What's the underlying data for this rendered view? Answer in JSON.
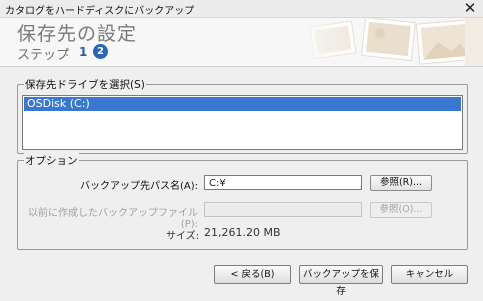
{
  "window": {
    "title": "カタログをハードディスクにバックアップ",
    "close_glyph": "✕"
  },
  "header": {
    "heading": "保存先の設定",
    "step_label": "ステップ",
    "step_separator": ":",
    "step1": "1",
    "step2": "2"
  },
  "drive_section": {
    "legend": "保存先ドライブを選択(S)",
    "items": [
      {
        "label": "OSDisk (C:)",
        "selected": true
      }
    ]
  },
  "options": {
    "legend": "オプション",
    "backup_path_label": "バックアップ先パス名(A):",
    "backup_path_value": "C:¥",
    "browse_label": "参照(R)...",
    "previous_file_label": "以前に作成したバックアップファイル(P):",
    "previous_file_value": "",
    "browse2_label": "参照(O)...",
    "size_label": "サイズ:",
    "size_value": "21,261.20 MB"
  },
  "footer": {
    "back_label": "< 戻る(B)",
    "save_label": "バックアップを保存",
    "cancel_label": "キャンセル"
  },
  "colors": {
    "selection": "#3a78d0",
    "step_badge": "#2a66b8"
  }
}
